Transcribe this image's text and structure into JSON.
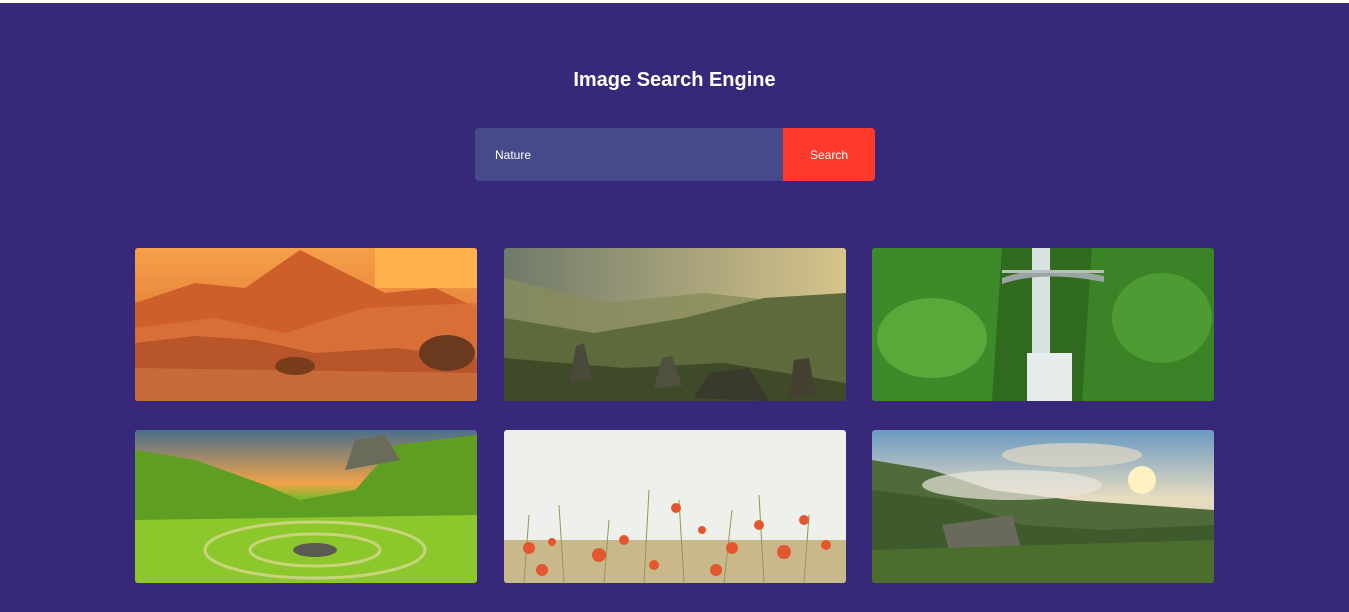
{
  "header": {
    "title": "Image Search Engine"
  },
  "search": {
    "value": "Nature",
    "button_label": "Search"
  },
  "results": [
    {
      "name": "desert-mountain-sunset-image"
    },
    {
      "name": "valley-rocks-hiker-image"
    },
    {
      "name": "waterfall-bridge-image"
    },
    {
      "name": "green-hills-stone-circle-image"
    },
    {
      "name": "poppy-field-image"
    },
    {
      "name": "misty-cliffs-sunrise-image"
    }
  ],
  "colors": {
    "background": "#38287a",
    "input": "#474a8a",
    "button": "#ff3a2d"
  }
}
